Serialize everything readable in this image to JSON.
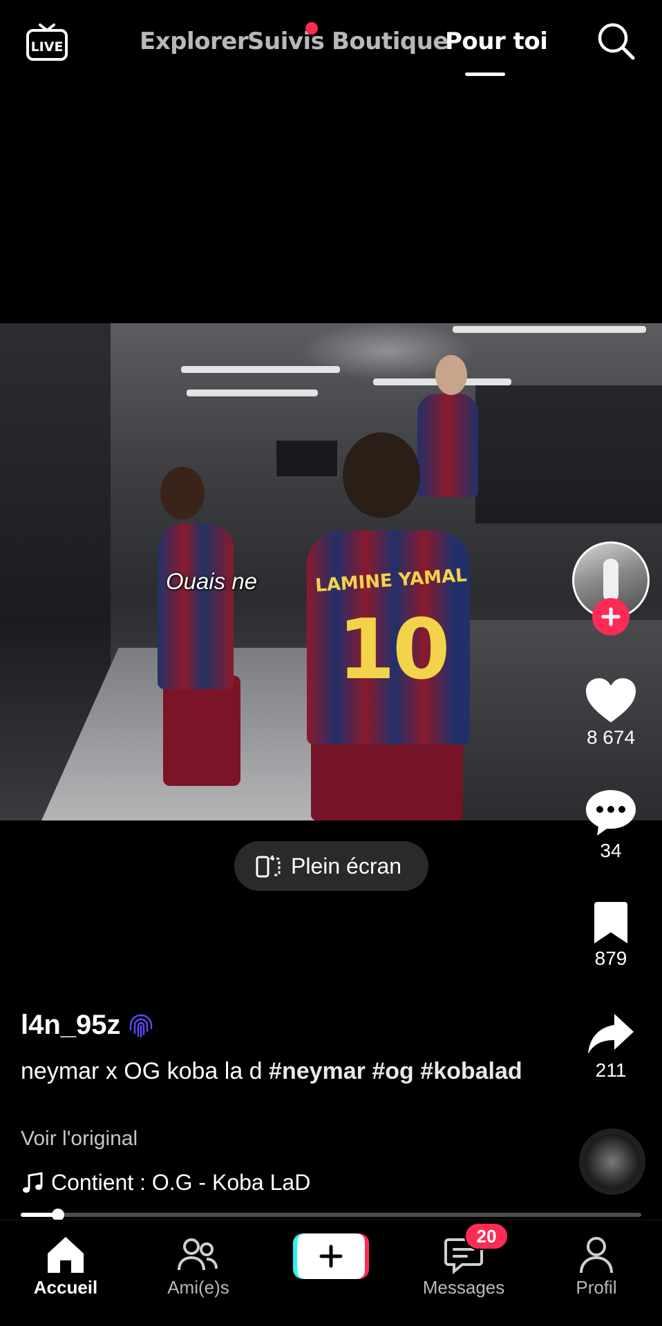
{
  "top_bar": {
    "live_label": "LIVE",
    "tabs": [
      {
        "label": "Explorer",
        "active": false
      },
      {
        "label": "Suivis",
        "active": false,
        "has_dot": true
      },
      {
        "label": "Boutique",
        "active": false
      },
      {
        "label": "Pour toi",
        "active": true
      }
    ]
  },
  "video": {
    "subtitle": "Ouais ne",
    "jersey_name": "LAMINE YAMAL",
    "jersey_number": "10",
    "fullscreen_label": "Plein écran"
  },
  "actions": {
    "likes": "8 674",
    "comments": "34",
    "bookmarks": "879",
    "shares": "211"
  },
  "post": {
    "username": "l4n_95z",
    "caption_text": "neymar x OG koba la d ",
    "hashtags": [
      "#neymar",
      "#og",
      "#kobalad"
    ],
    "see_original": "Voir l'original",
    "music": "Contient : O.G - Koba LaD"
  },
  "progress": {
    "fraction": 0.06
  },
  "bottom_nav": {
    "items": [
      {
        "label": "Accueil",
        "active": true
      },
      {
        "label": "Ami(e)s",
        "active": false
      },
      {
        "label": "Messages",
        "active": false,
        "badge": "20"
      },
      {
        "label": "Profil",
        "active": false
      }
    ]
  },
  "colors": {
    "accent": "#fe2c55",
    "cyan": "#25f4ee",
    "background": "#000000"
  }
}
